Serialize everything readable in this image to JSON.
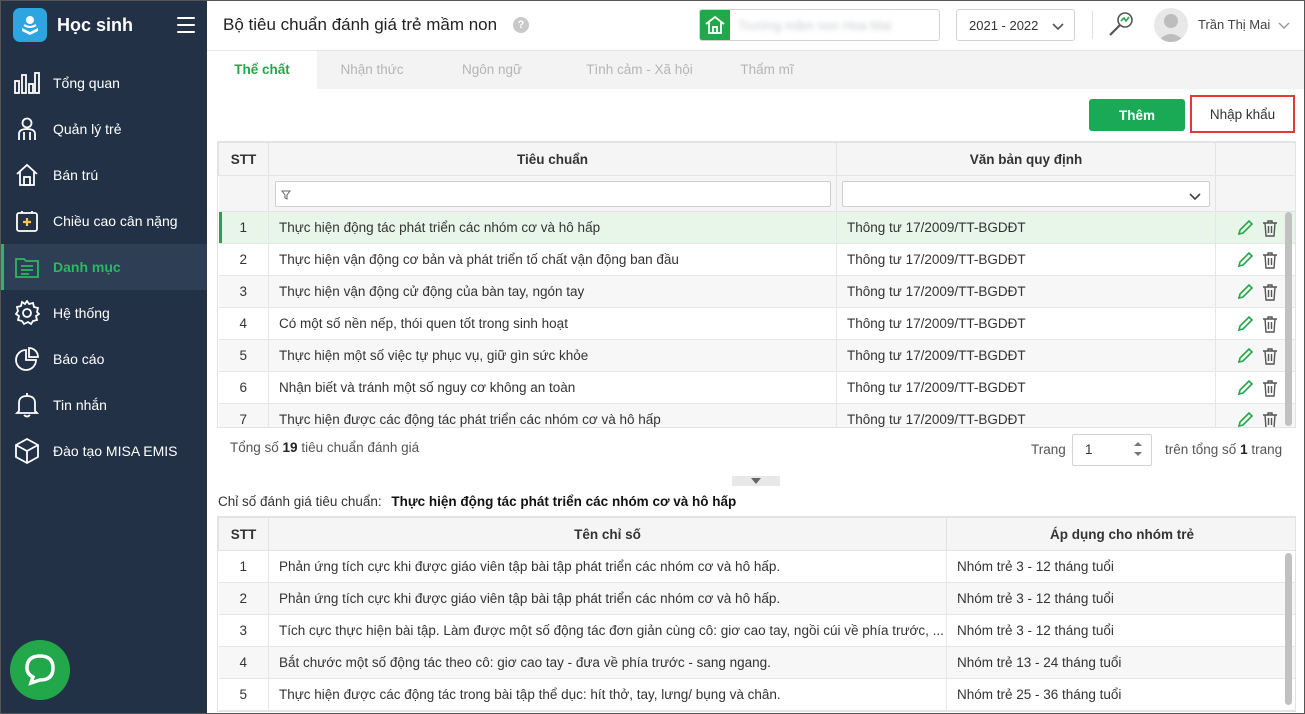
{
  "app": {
    "name": "Học sinh"
  },
  "sidebar": {
    "items": [
      {
        "label": "Tổng quan",
        "icon": "chart-bars-icon"
      },
      {
        "label": "Quản lý trẻ",
        "icon": "child-icon"
      },
      {
        "label": "Bán trú",
        "icon": "house-icon"
      },
      {
        "label": "Chiều cao cân nặng",
        "icon": "health-icon"
      },
      {
        "label": "Danh mục",
        "icon": "folder-list-icon",
        "active": true
      },
      {
        "label": "Hệ thống",
        "icon": "gear-icon"
      },
      {
        "label": "Báo cáo",
        "icon": "pie-chart-icon"
      },
      {
        "label": "Tin nhắn",
        "icon": "bell-icon"
      },
      {
        "label": "Đào tạo MISA EMIS",
        "icon": "cube-icon"
      }
    ]
  },
  "header": {
    "title": "Bộ tiêu chuẩn đánh giá trẻ mầm non",
    "help": "?",
    "school_name": "Trường mầm non Hoa Mai",
    "school_year": "2021 - 2022",
    "user_name": "Trần Thị Mai"
  },
  "tabs": [
    {
      "label": "Thể chất",
      "active": true
    },
    {
      "label": "Nhận thức"
    },
    {
      "label": "Ngôn ngữ"
    },
    {
      "label": "Tình cảm - Xã hội"
    },
    {
      "label": "Thẩm mĩ"
    }
  ],
  "toolbar": {
    "add_label": "Thêm",
    "import_label": "Nhập khẩu"
  },
  "standards_table": {
    "headers": {
      "stt": "STT",
      "name": "Tiêu chuẩn",
      "doc": "Văn bản quy định"
    },
    "rows": [
      {
        "stt": "1",
        "name": "Thực hiện động tác phát triển các nhóm cơ và hô hấp",
        "doc": "Thông tư 17/2009/TT-BGDĐT"
      },
      {
        "stt": "2",
        "name": "Thực hiện vận động cơ bản và phát triển tố chất vận động ban đầu",
        "doc": "Thông tư 17/2009/TT-BGDĐT"
      },
      {
        "stt": "3",
        "name": "Thực hiện vận động cử động của bàn tay, ngón tay",
        "doc": "Thông tư 17/2009/TT-BGDĐT"
      },
      {
        "stt": "4",
        "name": "Có một số nền nếp, thói quen tốt trong sinh hoạt",
        "doc": "Thông tư 17/2009/TT-BGDĐT"
      },
      {
        "stt": "5",
        "name": "Thực hiện một số việc tự phục vụ, giữ gìn sức khỏe",
        "doc": "Thông tư 17/2009/TT-BGDĐT"
      },
      {
        "stt": "6",
        "name": "Nhận biết và tránh một số nguy cơ không an toàn",
        "doc": "Thông tư 17/2009/TT-BGDĐT"
      },
      {
        "stt": "7",
        "name": "Thực hiện được các động tác phát triển các nhóm cơ và hô hấp",
        "doc": "Thông tư 17/2009/TT-BGDĐT"
      }
    ]
  },
  "footer": {
    "total_prefix": "Tổng số",
    "total_count": "19",
    "total_suffix": "tiêu chuẩn đánh giá",
    "page_label": "Trang",
    "page_value": "1",
    "total_pages_prefix": "trên tổng số",
    "total_pages": "1",
    "total_pages_suffix": "trang"
  },
  "detail": {
    "label": "Chỉ số đánh giá tiêu chuẩn:",
    "standard_name": "Thực hiện động tác phát triển các nhóm cơ và hô hấp"
  },
  "indicators_table": {
    "headers": {
      "stt": "STT",
      "name": "Tên chỉ số",
      "group": "Áp dụng cho nhóm trẻ"
    },
    "rows": [
      {
        "stt": "1",
        "name": "Phản ứng tích cực khi được giáo viên tập bài tập phát triển các nhóm cơ và hô hấp.",
        "group": "Nhóm trẻ 3 - 12 tháng tuổi"
      },
      {
        "stt": "2",
        "name": "Phản ứng tích cực khi được giáo viên tập bài tập phát triển các nhóm cơ và hô hấp.",
        "group": "Nhóm trẻ 3 - 12 tháng tuổi"
      },
      {
        "stt": "3",
        "name": "Tích cực thực hiện bài tập. Làm được một số động tác đơn giản cùng cô: giơ cao tay, ngồi cúi về phía trước, ...",
        "group": "Nhóm trẻ 3 - 12 tháng tuổi"
      },
      {
        "stt": "4",
        "name": "Bắt chước một số động tác theo cô: giơ cao tay - đưa về phía trước - sang ngang.",
        "group": "Nhóm trẻ 13 - 24 tháng tuổi"
      },
      {
        "stt": "5",
        "name": "Thực hiện được các động tác trong bài tập thể dục: hít thở, tay, lưng/ bụng và chân.",
        "group": "Nhóm trẻ 25 - 36 tháng tuổi"
      }
    ]
  },
  "colors": {
    "sidebar_bg": "#223146",
    "accent": "#22a84a",
    "import_border": "#e53935"
  }
}
